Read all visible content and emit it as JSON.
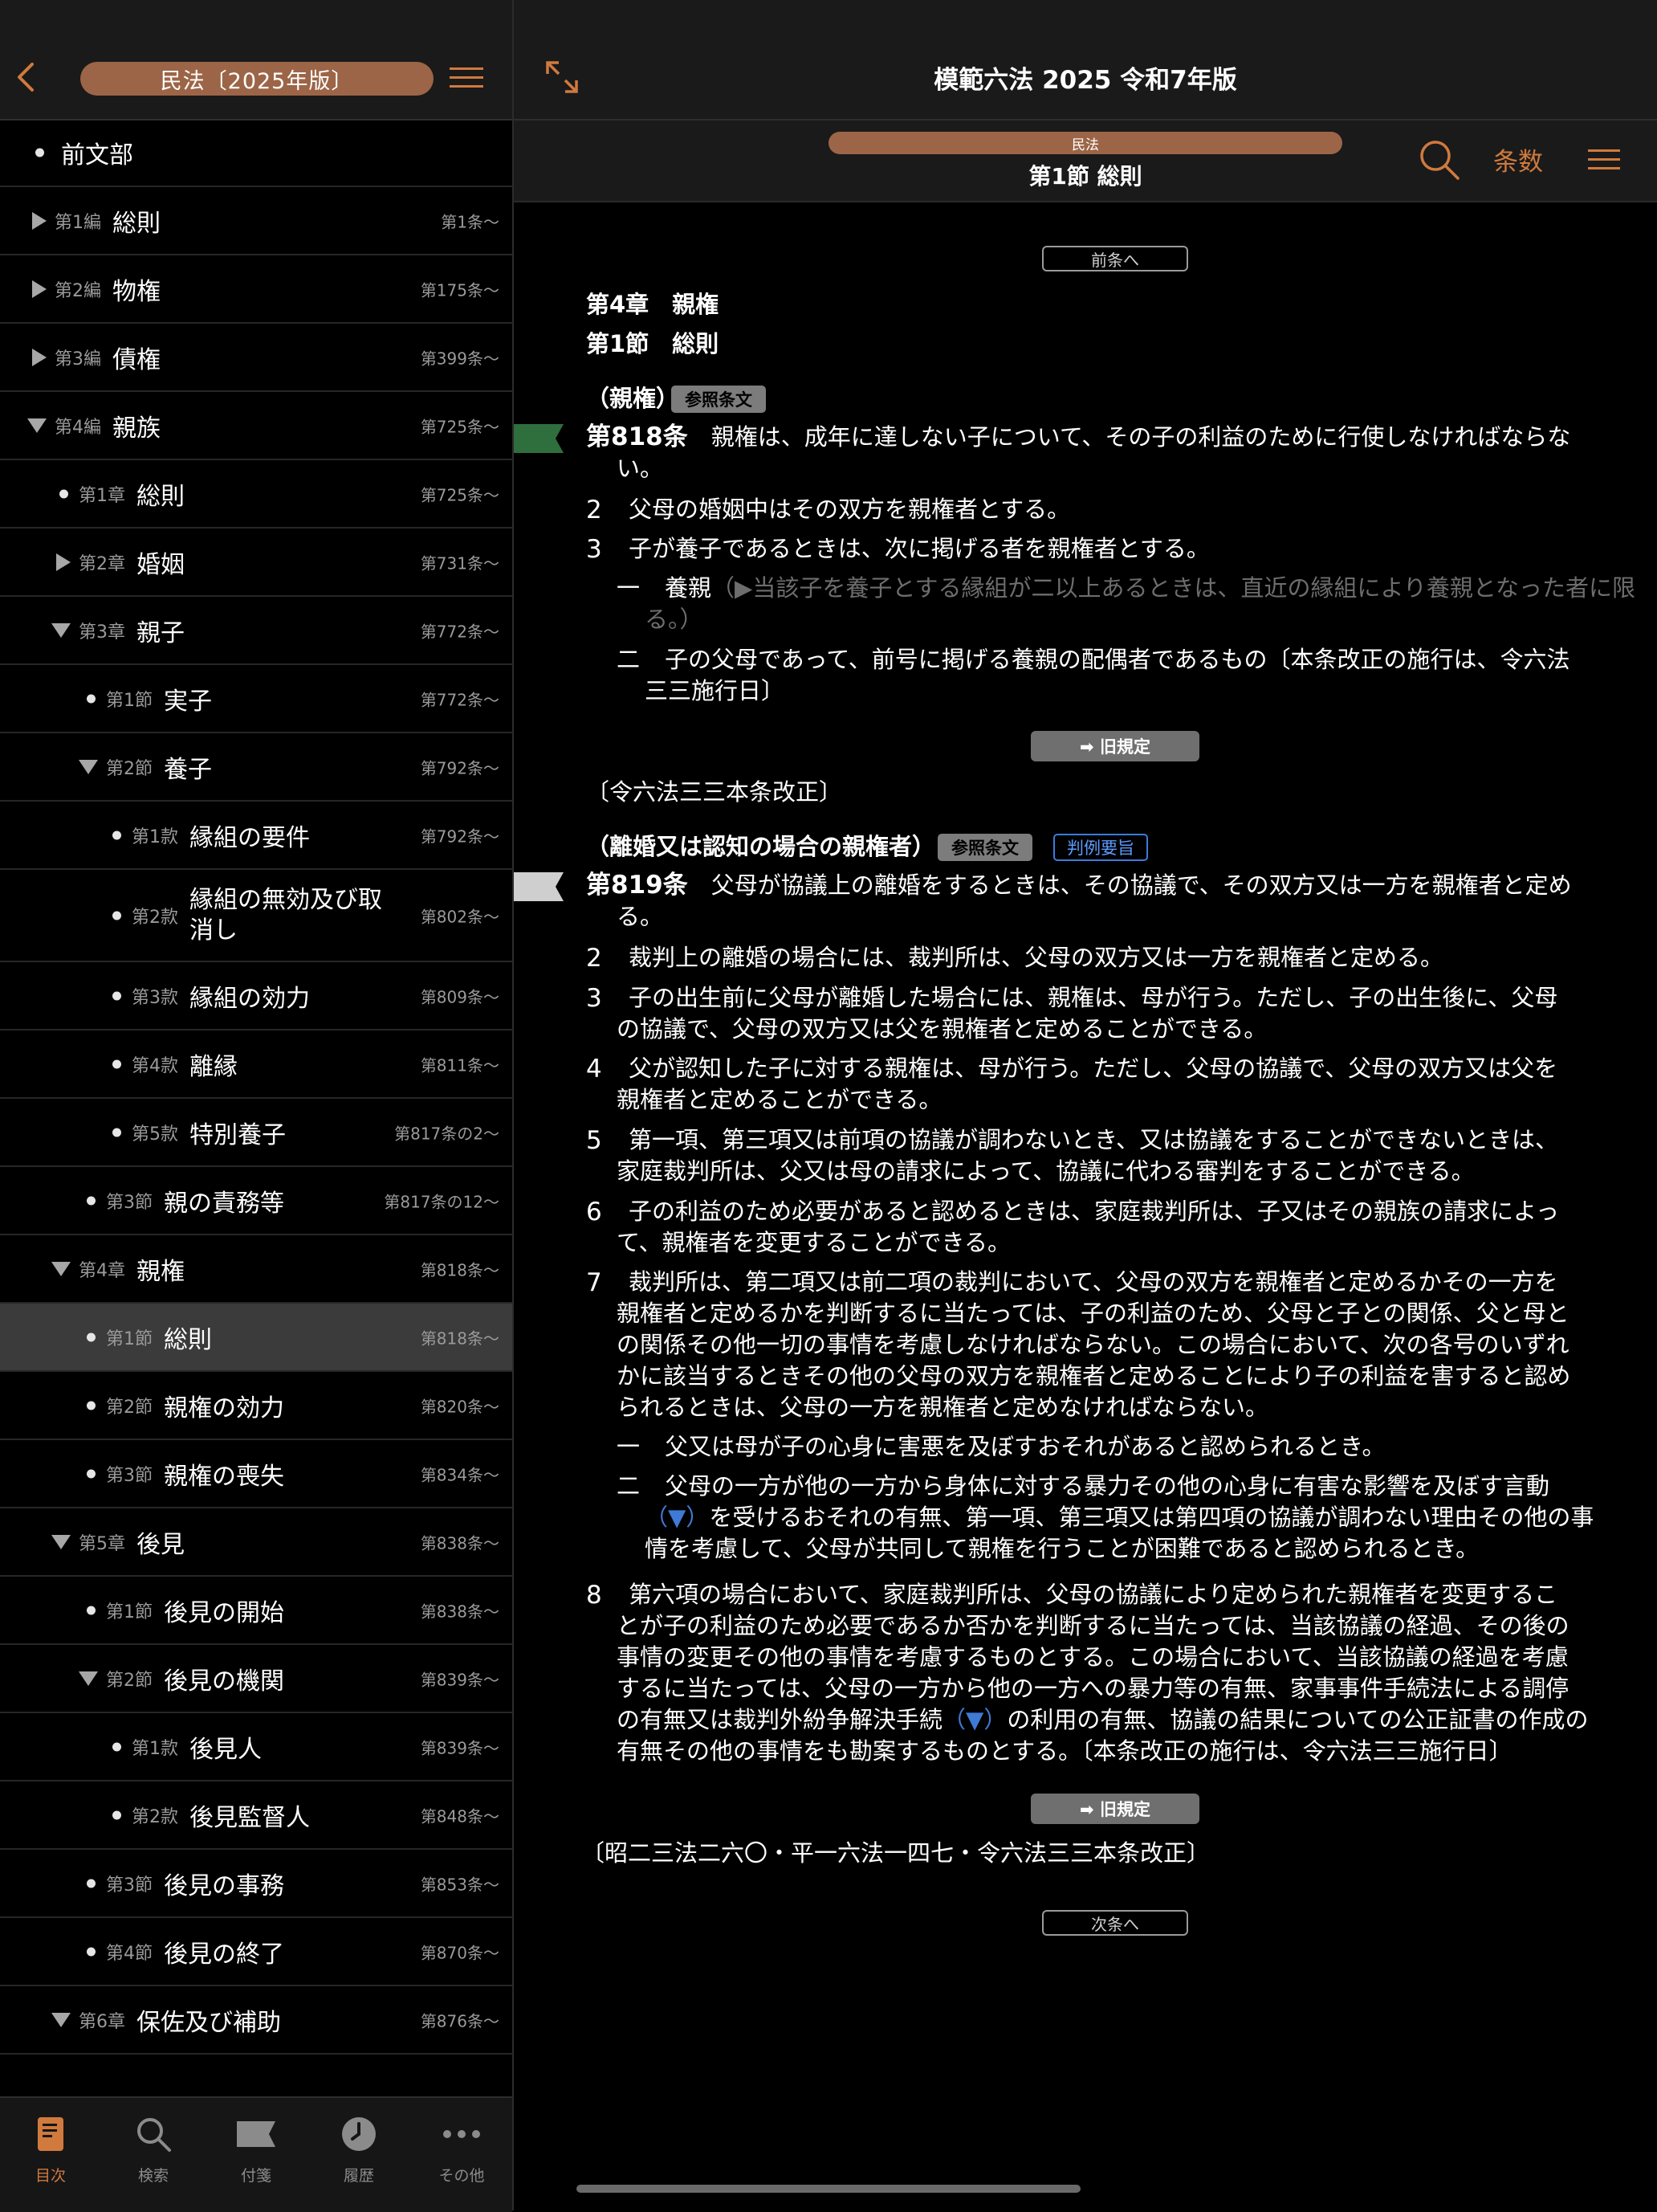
{
  "sidebar": {
    "book_title": "民法〔2025年版〕",
    "items": [
      {
        "marker": "bullet",
        "indent": 0,
        "level": "",
        "title": "前文部",
        "articles": ""
      },
      {
        "marker": "tri-right",
        "indent": 0,
        "level": "第1編",
        "title": "総則",
        "articles": "第1条〜"
      },
      {
        "marker": "tri-right",
        "indent": 0,
        "level": "第2編",
        "title": "物権",
        "articles": "第175条〜"
      },
      {
        "marker": "tri-right",
        "indent": 0,
        "level": "第3編",
        "title": "債権",
        "articles": "第399条〜"
      },
      {
        "marker": "tri-down",
        "indent": 0,
        "level": "第4編",
        "title": "親族",
        "articles": "第725条〜"
      },
      {
        "marker": "bullet",
        "indent": 1,
        "level": "第1章",
        "title": "総則",
        "articles": "第725条〜"
      },
      {
        "marker": "tri-right",
        "indent": 1,
        "level": "第2章",
        "title": "婚姻",
        "articles": "第731条〜"
      },
      {
        "marker": "tri-down",
        "indent": 1,
        "level": "第3章",
        "title": "親子",
        "articles": "第772条〜"
      },
      {
        "marker": "bullet",
        "indent": 2,
        "level": "第1節",
        "title": "実子",
        "articles": "第772条〜"
      },
      {
        "marker": "tri-down",
        "indent": 2,
        "level": "第2節",
        "title": "養子",
        "articles": "第792条〜"
      },
      {
        "marker": "bullet",
        "indent": 3,
        "level": "第1款",
        "title": "縁組の要件",
        "articles": "第792条〜"
      },
      {
        "marker": "bullet",
        "indent": 3,
        "level": "第2款",
        "title": "縁組の無効及び取消し",
        "articles": "第802条〜",
        "tall": true
      },
      {
        "marker": "bullet",
        "indent": 3,
        "level": "第3款",
        "title": "縁組の効力",
        "articles": "第809条〜"
      },
      {
        "marker": "bullet",
        "indent": 3,
        "level": "第4款",
        "title": "離縁",
        "articles": "第811条〜"
      },
      {
        "marker": "bullet",
        "indent": 3,
        "level": "第5款",
        "title": "特別養子",
        "articles": "第817条の2〜"
      },
      {
        "marker": "bullet",
        "indent": 2,
        "level": "第3節",
        "title": "親の責務等",
        "articles": "第817条の12〜"
      },
      {
        "marker": "tri-down",
        "indent": 1,
        "level": "第4章",
        "title": "親権",
        "articles": "第818条〜"
      },
      {
        "marker": "bullet",
        "indent": 2,
        "level": "第1節",
        "title": "総則",
        "articles": "第818条〜",
        "selected": true
      },
      {
        "marker": "bullet",
        "indent": 2,
        "level": "第2節",
        "title": "親権の効力",
        "articles": "第820条〜"
      },
      {
        "marker": "bullet",
        "indent": 2,
        "level": "第3節",
        "title": "親権の喪失",
        "articles": "第834条〜"
      },
      {
        "marker": "tri-down",
        "indent": 1,
        "level": "第5章",
        "title": "後見",
        "articles": "第838条〜"
      },
      {
        "marker": "bullet",
        "indent": 2,
        "level": "第1節",
        "title": "後見の開始",
        "articles": "第838条〜"
      },
      {
        "marker": "tri-down",
        "indent": 2,
        "level": "第2節",
        "title": "後見の機関",
        "articles": "第839条〜"
      },
      {
        "marker": "bullet",
        "indent": 3,
        "level": "第1款",
        "title": "後見人",
        "articles": "第839条〜"
      },
      {
        "marker": "bullet",
        "indent": 3,
        "level": "第2款",
        "title": "後見監督人",
        "articles": "第848条〜"
      },
      {
        "marker": "bullet",
        "indent": 2,
        "level": "第3節",
        "title": "後見の事務",
        "articles": "第853条〜"
      },
      {
        "marker": "bullet",
        "indent": 2,
        "level": "第4節",
        "title": "後見の終了",
        "articles": "第870条〜"
      },
      {
        "marker": "tri-down",
        "indent": 1,
        "level": "第6章",
        "title": "保佐及び補助",
        "articles": "第876条〜"
      }
    ]
  },
  "tabbar": {
    "toc": "目次",
    "search": "検索",
    "tags": "付箋",
    "history": "履歴",
    "more": "その他"
  },
  "header": {
    "app_title": "模範六法 2025 令和7年版",
    "law_name": "民法",
    "section_title": "第1節 総則",
    "articles_label": "条数"
  },
  "colors": {
    "accent": "#d07a3e",
    "pill": "#9c6547",
    "bookmark_green": "#2f6e3d",
    "bookmark_gray": "#cfcfcf"
  },
  "content": {
    "prev_label": "前条へ",
    "next_label": "次条へ",
    "chapter": "第4章　親権",
    "section": "第1節　総則",
    "ref_tag": "参照条文",
    "case_tag": "判例要旨",
    "old_rule": "➡ 旧規定",
    "a818": {
      "caption": "（親権）",
      "number": "第818条",
      "p1a": "親権は、成年に達しない子について、その子の利益のために行使しなければならな",
      "p1b": "い。",
      "p2": "父母の婚姻中はその双方を親権者とする。",
      "p3": "子が養子であるときは、次に掲げる者を親権者とする。",
      "i1_label": "養親",
      "i1_note_a": "（▶当該子を養子とする縁組が二以上あるときは、直近の縁組により養親となった者に限",
      "i1_note_b": "る。）",
      "i2a": "子の父母であって、前号に掲げる養親の配偶者であるもの〔本条改正の施行は、令六法",
      "i2b": "三三施行日〕",
      "history": "〔令六法三三本条改正〕"
    },
    "a819": {
      "caption": "（離婚又は認知の場合の親権者）",
      "number": "第819条",
      "p1a": "父母が協議上の離婚をするときは、その協議で、その双方又は一方を親権者と定め",
      "p1b": "る。",
      "p2": "裁判上の離婚の場合には、裁判所は、父母の双方又は一方を親権者と定める。",
      "p3a": "子の出生前に父母が離婚した場合には、親権は、母が行う。ただし、子の出生後に、父母",
      "p3b": "の協議で、父母の双方又は父を親権者と定めることができる。",
      "p4a": "父が認知した子に対する親権は、母が行う。ただし、父母の協議で、父母の双方又は父を",
      "p4b": "親権者と定めることができる。",
      "p5a": "第一項、第三項又は前項の協議が調わないとき、又は協議をすることができないときは、",
      "p5b": "家庭裁判所は、父又は母の請求によって、協議に代わる審判をすることができる。",
      "p6a": "子の利益のため必要があると認めるときは、家庭裁判所は、子又はその親族の請求によっ",
      "p6b": "て、親権者を変更することができる。",
      "p7a": "裁判所は、第二項又は前二項の裁判において、父母の双方を親権者と定めるかその一方を",
      "p7b": "親権者と定めるかを判断するに当たっては、子の利益のため、父母と子との関係、父と母と",
      "p7c": "の関係その他一切の事情を考慮しなければならない。この場合において、次の各号のいずれ",
      "p7d": "かに該当するときその他の父母の双方を親権者と定めることにより子の利益を害すると認め",
      "p7e": "られるときは、父母の一方を親権者と定めなければならない。",
      "i1": "父又は母が子の心身に害悪を及ぼすおそれがあると認められるとき。",
      "i2a": "父母の一方が他の一方から身体に対する暴力その他の心身に有害な影響を及ぼす言動",
      "i2b_mark": "（▼）",
      "i2b": "を受けるおそれの有無、第一項、第三項又は第四項の協議が調わない理由その他の事",
      "i2c": "情を考慮して、父母が共同して親権を行うことが困難であると認められるとき。",
      "p8a": "第六項の場合において、家庭裁判所は、父母の協議により定められた親権者を変更するこ",
      "p8b": "とが子の利益のため必要であるか否かを判断するに当たっては、当該協議の経過、その後の",
      "p8c": "事情の変更その他の事情を考慮するものとする。この場合において、当該協議の経過を考慮",
      "p8d": "するに当たっては、父母の一方から他の一方への暴力等の有無、家事事件手続法による調停",
      "p8e1": "の有無又は裁判外紛争解決手続",
      "p8e_mark": "（▼）",
      "p8e2": "の利用の有無、協議の結果についての公正証書の作成の",
      "p8f": "有無その他の事情をも勘案するものとする。〔本条改正の施行は、令六法三三施行日〕",
      "history": "〔昭二三法二六〇・平一六法一四七・令六法三三本条改正〕"
    },
    "nums": {
      "n1": "一",
      "n2": "二",
      "d2": "2",
      "d3": "3",
      "d4": "4",
      "d5": "5",
      "d6": "6",
      "d7": "7",
      "d8": "8"
    }
  }
}
